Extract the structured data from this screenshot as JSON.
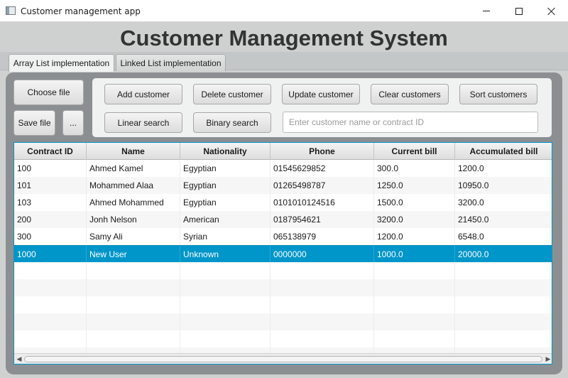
{
  "window": {
    "title": "Customer management app",
    "icons": {
      "app": "app-window-icon",
      "minimize": "minimize-icon",
      "maximize": "maximize-icon",
      "close": "close-icon"
    }
  },
  "header": {
    "title": "Customer Management System"
  },
  "tabs": [
    {
      "label": "Array List implementation",
      "active": true
    },
    {
      "label": "Linked List implementation",
      "active": false
    }
  ],
  "file_controls": {
    "choose_file": "Choose file",
    "save_file": "Save file",
    "more": "..."
  },
  "actions": {
    "add": "Add customer",
    "delete": "Delete customer",
    "update": "Update customer",
    "clear": "Clear customers",
    "sort": "Sort customers",
    "linear_search": "Linear search",
    "binary_search": "Binary search"
  },
  "search": {
    "placeholder": "Enter customer name or contract ID",
    "value": ""
  },
  "table": {
    "columns": [
      "Contract ID",
      "Name",
      "Nationality",
      "Phone",
      "Current bill",
      "Accumulated bill"
    ],
    "rows": [
      [
        "100",
        "Ahmed Kamel",
        "Egyptian",
        "01545629852",
        "300.0",
        "1200.0"
      ],
      [
        "101",
        "Mohammed Alaa",
        "Egyptian",
        "01265498787",
        "1250.0",
        "10950.0"
      ],
      [
        "103",
        "Ahmed Mohammed",
        "Egyptian",
        "0101010124516",
        "1500.0",
        "3200.0"
      ],
      [
        "200",
        "Jonh Nelson",
        "American",
        "0187954621",
        "3200.0",
        "21450.0"
      ],
      [
        "300",
        "Samy Ali",
        "Syrian",
        "065138979",
        "1200.0",
        "6548.0"
      ],
      [
        "1000",
        "New User",
        "Unknown",
        "0000000",
        "1000.0",
        "20000.0"
      ]
    ],
    "selected_row": 5,
    "empty_rows": 6
  },
  "colors": {
    "accent": "#0096c9",
    "panel_bg": "#8c8f91",
    "window_bg": "#cfd1d1"
  }
}
